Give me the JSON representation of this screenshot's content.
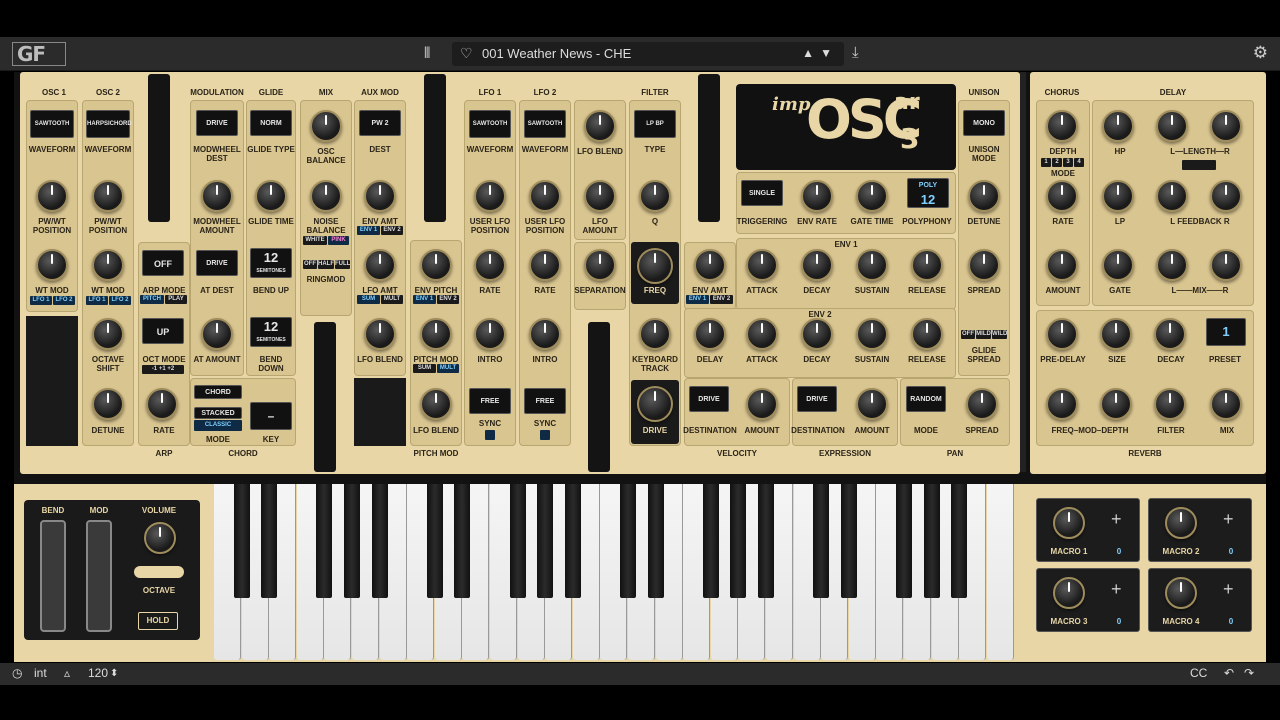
{
  "header": {
    "logo": "GF",
    "preset": "001 Weather News - CHE",
    "up": "▲",
    "down": "▼"
  },
  "osc": {
    "osc1": "OSC 1",
    "osc2": "OSC 2",
    "waveform1": "SAWTOOTH",
    "waveform2": "HARPSICHORD",
    "waveform_label": "WAVEFORM",
    "pwwt": "PW/WT POSITION",
    "wtmod": "WT MOD",
    "lfo1": "LFO 1",
    "lfo2": "LFO 2",
    "octave": "OCTAVE SHIFT",
    "detune": "DETUNE"
  },
  "arp": {
    "off": "OFF",
    "mode_val": "UP",
    "arp_mode": "ARP MODE",
    "pitch": "PITCH",
    "play": "PLAY",
    "oct_mode": "OCT MODE",
    "oct_opts": "-1  +1  +2",
    "rate": "RATE",
    "footer": "ARP"
  },
  "modulation": {
    "title": "MODULATION",
    "drive": "DRIVE",
    "modwheel_dest": "MODWHEEL DEST",
    "modwheel_amount": "MODWHEEL AMOUNT",
    "drive2": "DRIVE",
    "at_dest": "AT DEST",
    "at_amount": "AT AMOUNT",
    "chord": "CHORD",
    "stacked": "STACKED",
    "classic": "CLASSIC",
    "mode": "MODE",
    "key": "KEY",
    "key_val": "–",
    "footer": "CHORD"
  },
  "glide": {
    "title": "GLIDE",
    "norm": "NORM",
    "glide_type": "GLIDE TYPE",
    "glide_time": "GLIDE TIME",
    "bend_up_val": "12",
    "semitones": "SEMITONES",
    "bend_up": "BEND UP",
    "bend_down_val": "12",
    "bend_down": "BEND DOWN"
  },
  "mix": {
    "title": "MIX",
    "osc_balance": "OSC BALANCE",
    "noise_balance": "NOISE BALANCE",
    "white": "WHITE",
    "pink": "PINK",
    "off": "OFF",
    "half": "HALF",
    "full": "FULL",
    "ringmod": "RINGMOD"
  },
  "auxmod": {
    "title": "AUX MOD",
    "pw2": "PW 2",
    "dest": "DEST",
    "env_amt": "ENV AMT",
    "env1": "ENV 1",
    "env2": "ENV 2",
    "lfo_amt": "LFO AMT",
    "sum": "SUM",
    "mult": "MULT",
    "lfo_blend": "LFO BLEND"
  },
  "pitchmod": {
    "env_pitch": "ENV PITCH",
    "env1": "ENV 1",
    "env2": "ENV 2",
    "pitch_mod": "PITCH MOD",
    "sum": "SUM",
    "mult": "MULT",
    "lfo_blend": "LFO BLEND",
    "footer": "PITCH MOD"
  },
  "lfo": {
    "lfo1": "LFO 1",
    "lfo2": "LFO 2",
    "waveform1": "SAWTOOTH",
    "waveform2": "SAWTOOTH",
    "waveform": "WAVEFORM",
    "user_lfo": "USER LFO POSITION",
    "rate": "RATE",
    "intro": "INTRO",
    "free": "FREE",
    "sync": "SYNC",
    "lfo_blend": "LFO BLEND",
    "lfo_amount": "LFO AMOUNT",
    "separation": "SEPARATION"
  },
  "filter": {
    "title": "FILTER",
    "type_val": "LP  BP",
    "type": "TYPE",
    "q": "Q",
    "freq": "FREQ",
    "keyboard_track": "KEYBOARD TRACK",
    "drive": "DRIVE",
    "env_amt": "ENV AMT",
    "env1": "ENV 1",
    "env2": "ENV 2"
  },
  "logo": {
    "imp": "imp",
    "osc": "OSC",
    "ar": "ar",
    "three": "3"
  },
  "env": {
    "triggering_val": "SINGLE",
    "triggering": "TRIGGERING",
    "env_rate": "ENV RATE",
    "gate_time": "GATE TIME",
    "poly": "POLY",
    "poly_val": "12",
    "polyphony": "POLYPHONY",
    "env1": "ENV 1",
    "env2": "ENV 2",
    "attack": "ATTACK",
    "decay": "DECAY",
    "sustain": "SUSTAIN",
    "release": "RELEASE",
    "delay": "DELAY"
  },
  "unison": {
    "title": "UNISON",
    "mono": "MONO",
    "unison_mode": "UNISON MODE",
    "detune": "DETUNE",
    "spread": "SPREAD",
    "off": "OFF",
    "mild": "MILD",
    "wild": "WILD",
    "glide_spread": "GLIDE SPREAD"
  },
  "vel": {
    "drive1": "DRIVE",
    "drive2": "DRIVE",
    "random": "RANDOM",
    "destination": "DESTINATION",
    "amount": "AMOUNT",
    "mode": "MODE",
    "spread": "SPREAD",
    "velocity": "VELOCITY",
    "expression": "EXPRESSION",
    "pan": "PAN"
  },
  "chorus": {
    "title": "CHORUS",
    "depth": "DEPTH",
    "modes": [
      "1",
      "2",
      "3",
      "4"
    ],
    "mode": "MODE",
    "rate": "RATE",
    "amount": "AMOUNT"
  },
  "delay": {
    "title": "DELAY",
    "hp": "HP",
    "lp": "LP",
    "length": "L—LENGTH—R",
    "feedback": "L FEEDBACK R",
    "gate": "GATE",
    "mix": "L——MIX——R"
  },
  "reverb": {
    "pre_delay": "PRE-DELAY",
    "size": "SIZE",
    "decay": "DECAY",
    "preset": "PRESET",
    "preset_val": "1",
    "freq_mod": "FREQ–MOD–DEPTH",
    "filter": "FILTER",
    "mix": "MIX",
    "footer": "REVERB"
  },
  "perf": {
    "bend": "BEND",
    "mod": "MOD",
    "volume": "VOLUME",
    "octave": "OCTAVE",
    "hold": "HOLD"
  },
  "macros": [
    {
      "label": "MACRO 1",
      "value": "0"
    },
    {
      "label": "MACRO 2",
      "value": "0"
    },
    {
      "label": "MACRO 3",
      "value": "0"
    },
    {
      "label": "MACRO 4",
      "value": "0"
    }
  ],
  "footerbar": {
    "clock": "int",
    "tempo": "120",
    "tempo_arrows": "⬍",
    "cc": "CC",
    "undo": "↶",
    "redo": "↷"
  }
}
